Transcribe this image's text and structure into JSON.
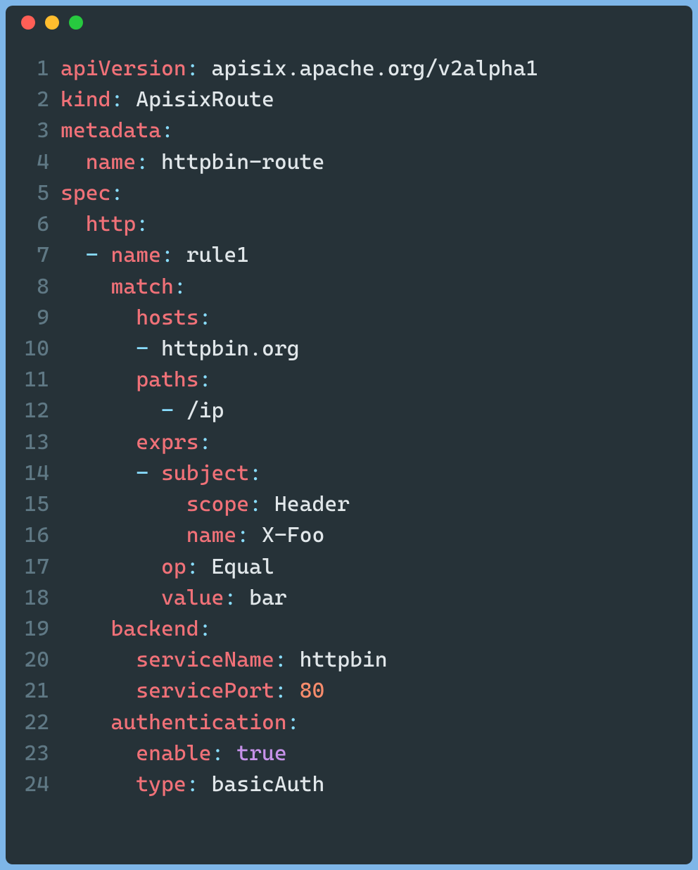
{
  "colors": {
    "bg": "#263238",
    "key": "#f07178",
    "punc": "#89ddff",
    "str": "#e1e7ea",
    "num": "#f78c6c",
    "bool": "#c792ea",
    "gutter": "#5f7884",
    "pageBg": "#7eb6e8"
  },
  "lines": [
    {
      "n": "1",
      "indent": 0,
      "tokens": [
        {
          "t": "key",
          "v": "apiVersion"
        },
        {
          "t": "punc",
          "v": ":"
        },
        {
          "t": "sp",
          "v": " "
        },
        {
          "t": "str",
          "v": "apisix.apache.org/v2alpha1"
        }
      ]
    },
    {
      "n": "2",
      "indent": 0,
      "tokens": [
        {
          "t": "key",
          "v": "kind"
        },
        {
          "t": "punc",
          "v": ":"
        },
        {
          "t": "sp",
          "v": " "
        },
        {
          "t": "str",
          "v": "ApisixRoute"
        }
      ]
    },
    {
      "n": "3",
      "indent": 0,
      "tokens": [
        {
          "t": "key",
          "v": "metadata"
        },
        {
          "t": "punc",
          "v": ":"
        }
      ]
    },
    {
      "n": "4",
      "indent": 1,
      "tokens": [
        {
          "t": "key",
          "v": "name"
        },
        {
          "t": "punc",
          "v": ":"
        },
        {
          "t": "sp",
          "v": " "
        },
        {
          "t": "str",
          "v": "httpbin-route"
        }
      ]
    },
    {
      "n": "5",
      "indent": 0,
      "tokens": [
        {
          "t": "key",
          "v": "spec"
        },
        {
          "t": "punc",
          "v": ":"
        }
      ]
    },
    {
      "n": "6",
      "indent": 1,
      "tokens": [
        {
          "t": "key",
          "v": "http"
        },
        {
          "t": "punc",
          "v": ":"
        }
      ]
    },
    {
      "n": "7",
      "indent": 1,
      "tokens": [
        {
          "t": "dash",
          "v": "-"
        },
        {
          "t": "sp",
          "v": " "
        },
        {
          "t": "key",
          "v": "name"
        },
        {
          "t": "punc",
          "v": ":"
        },
        {
          "t": "sp",
          "v": " "
        },
        {
          "t": "str",
          "v": "rule1"
        }
      ]
    },
    {
      "n": "8",
      "indent": 2,
      "tokens": [
        {
          "t": "key",
          "v": "match"
        },
        {
          "t": "punc",
          "v": ":"
        }
      ]
    },
    {
      "n": "9",
      "indent": 3,
      "tokens": [
        {
          "t": "key",
          "v": "hosts"
        },
        {
          "t": "punc",
          "v": ":"
        }
      ]
    },
    {
      "n": "10",
      "indent": 3,
      "tokens": [
        {
          "t": "dash",
          "v": "-"
        },
        {
          "t": "sp",
          "v": " "
        },
        {
          "t": "str",
          "v": "httpbin.org"
        }
      ]
    },
    {
      "n": "11",
      "indent": 3,
      "tokens": [
        {
          "t": "key",
          "v": "paths"
        },
        {
          "t": "punc",
          "v": ":"
        }
      ]
    },
    {
      "n": "12",
      "indent": 4,
      "tokens": [
        {
          "t": "dash",
          "v": "-"
        },
        {
          "t": "sp",
          "v": " "
        },
        {
          "t": "str",
          "v": "/ip"
        }
      ]
    },
    {
      "n": "13",
      "indent": 3,
      "tokens": [
        {
          "t": "key",
          "v": "exprs"
        },
        {
          "t": "punc",
          "v": ":"
        }
      ]
    },
    {
      "n": "14",
      "indent": 3,
      "tokens": [
        {
          "t": "dash",
          "v": "-"
        },
        {
          "t": "sp",
          "v": " "
        },
        {
          "t": "key",
          "v": "subject"
        },
        {
          "t": "punc",
          "v": ":"
        }
      ]
    },
    {
      "n": "15",
      "indent": 5,
      "tokens": [
        {
          "t": "key",
          "v": "scope"
        },
        {
          "t": "punc",
          "v": ":"
        },
        {
          "t": "sp",
          "v": " "
        },
        {
          "t": "str",
          "v": "Header"
        }
      ]
    },
    {
      "n": "16",
      "indent": 5,
      "tokens": [
        {
          "t": "key",
          "v": "name"
        },
        {
          "t": "punc",
          "v": ":"
        },
        {
          "t": "sp",
          "v": " "
        },
        {
          "t": "str",
          "v": "X-Foo"
        }
      ]
    },
    {
      "n": "17",
      "indent": 4,
      "tokens": [
        {
          "t": "key",
          "v": "op"
        },
        {
          "t": "punc",
          "v": ":"
        },
        {
          "t": "sp",
          "v": " "
        },
        {
          "t": "str",
          "v": "Equal"
        }
      ]
    },
    {
      "n": "18",
      "indent": 4,
      "tokens": [
        {
          "t": "key",
          "v": "value"
        },
        {
          "t": "punc",
          "v": ":"
        },
        {
          "t": "sp",
          "v": " "
        },
        {
          "t": "str",
          "v": "bar"
        }
      ]
    },
    {
      "n": "19",
      "indent": 2,
      "tokens": [
        {
          "t": "key",
          "v": "backend"
        },
        {
          "t": "punc",
          "v": ":"
        }
      ]
    },
    {
      "n": "20",
      "indent": 3,
      "tokens": [
        {
          "t": "key",
          "v": "serviceName"
        },
        {
          "t": "punc",
          "v": ":"
        },
        {
          "t": "sp",
          "v": " "
        },
        {
          "t": "str",
          "v": "httpbin"
        }
      ]
    },
    {
      "n": "21",
      "indent": 3,
      "tokens": [
        {
          "t": "key",
          "v": "servicePort"
        },
        {
          "t": "punc",
          "v": ":"
        },
        {
          "t": "sp",
          "v": " "
        },
        {
          "t": "num",
          "v": "80"
        }
      ]
    },
    {
      "n": "22",
      "indent": 2,
      "tokens": [
        {
          "t": "key",
          "v": "authentication"
        },
        {
          "t": "punc",
          "v": ":"
        }
      ]
    },
    {
      "n": "23",
      "indent": 3,
      "tokens": [
        {
          "t": "key",
          "v": "enable"
        },
        {
          "t": "punc",
          "v": ":"
        },
        {
          "t": "sp",
          "v": " "
        },
        {
          "t": "bool",
          "v": "true"
        }
      ]
    },
    {
      "n": "24",
      "indent": 3,
      "tokens": [
        {
          "t": "key",
          "v": "type"
        },
        {
          "t": "punc",
          "v": ":"
        },
        {
          "t": "sp",
          "v": " "
        },
        {
          "t": "str",
          "v": "basicAuth"
        }
      ]
    }
  ]
}
